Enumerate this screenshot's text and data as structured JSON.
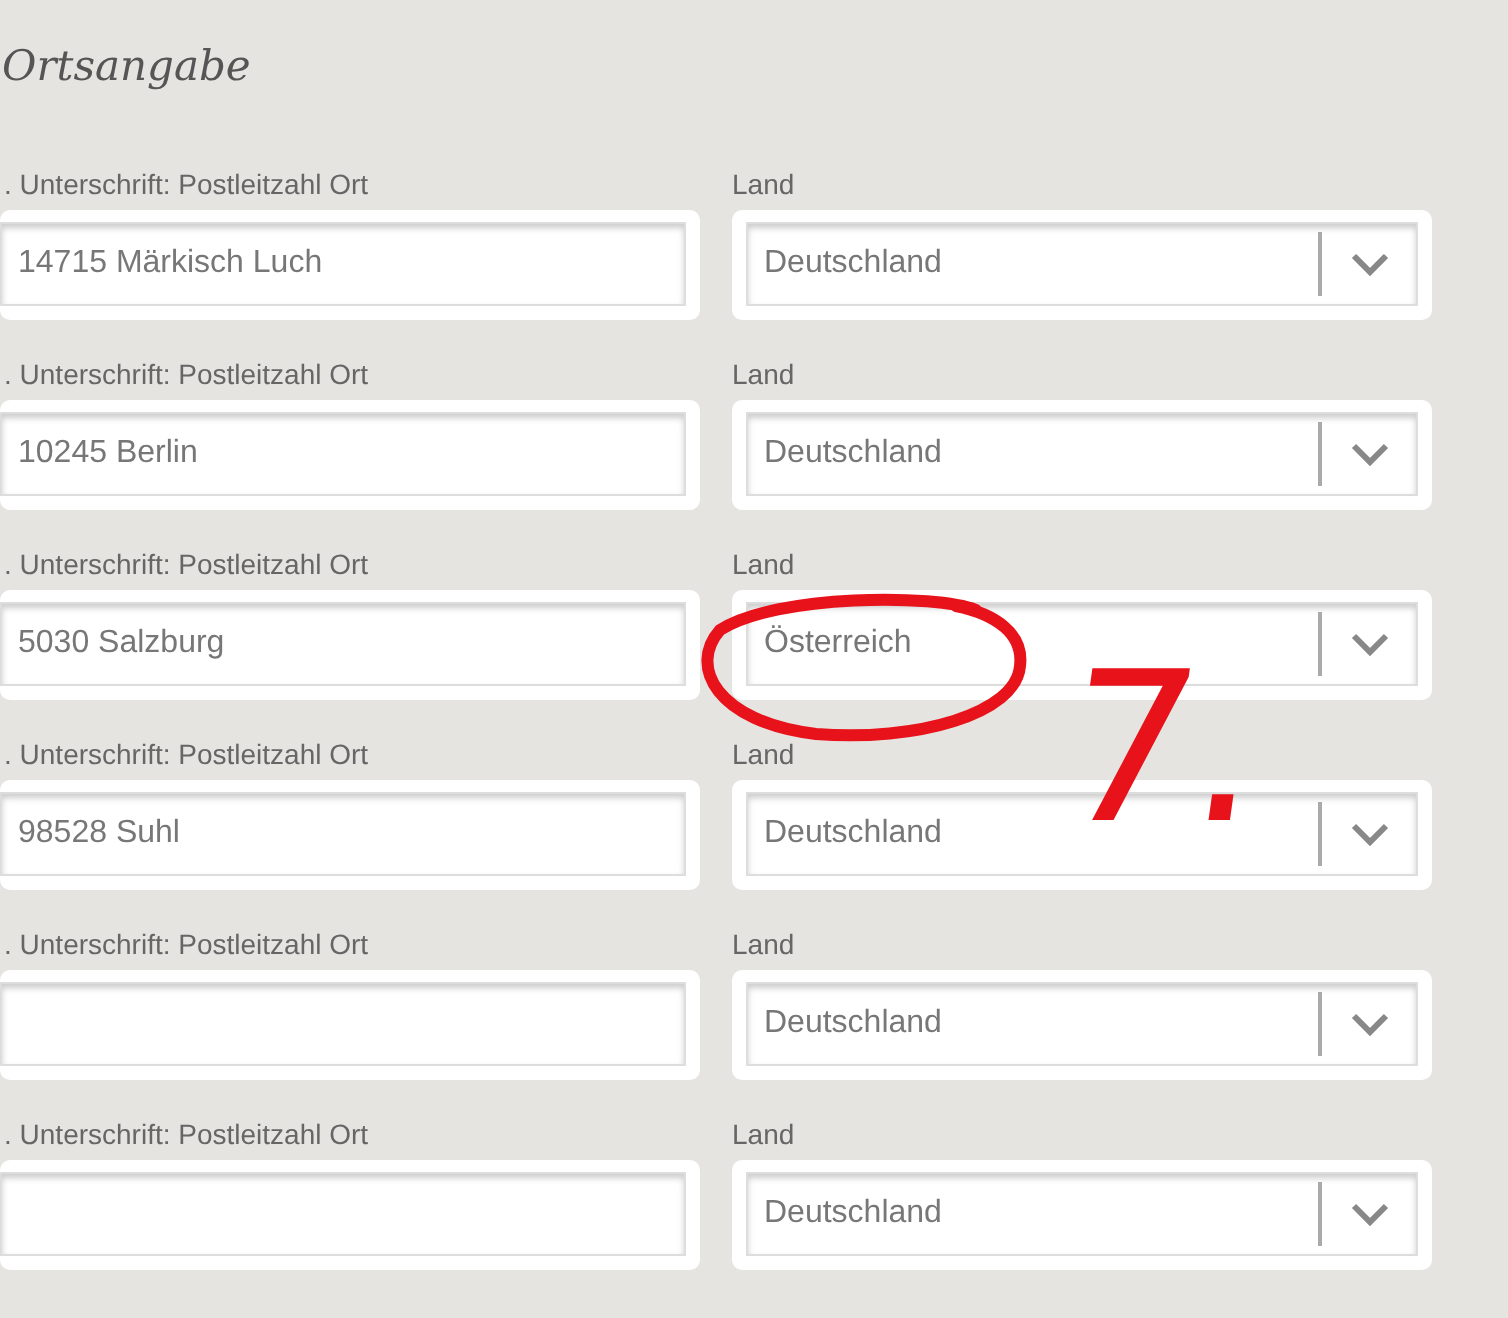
{
  "section_title": "Ortsangabe",
  "rows": [
    {
      "place_label": ". Unterschrift: Postleitzahl Ort",
      "place_value": "14715 Märkisch Luch",
      "country_label": "Land",
      "country_value": "Deutschland",
      "circled": false
    },
    {
      "place_label": ". Unterschrift: Postleitzahl Ort",
      "place_value": "10245 Berlin",
      "country_label": "Land",
      "country_value": "Deutschland",
      "circled": false
    },
    {
      "place_label": ". Unterschrift: Postleitzahl Ort",
      "place_value": "5030 Salzburg",
      "country_label": "Land",
      "country_value": "Österreich",
      "circled": true
    },
    {
      "place_label": ". Unterschrift: Postleitzahl Ort",
      "place_value": "98528 Suhl",
      "country_label": "Land",
      "country_value": "Deutschland",
      "circled": false
    },
    {
      "place_label": ". Unterschrift: Postleitzahl Ort",
      "country_label": "Land",
      "country_value": "Deutschland",
      "circled": false
    },
    {
      "place_label": ". Unterschrift: Postleitzahl Ort",
      "country_label": "Land",
      "country_value": "Deutschland",
      "circled": false
    }
  ],
  "annotation": {
    "text": "7."
  }
}
